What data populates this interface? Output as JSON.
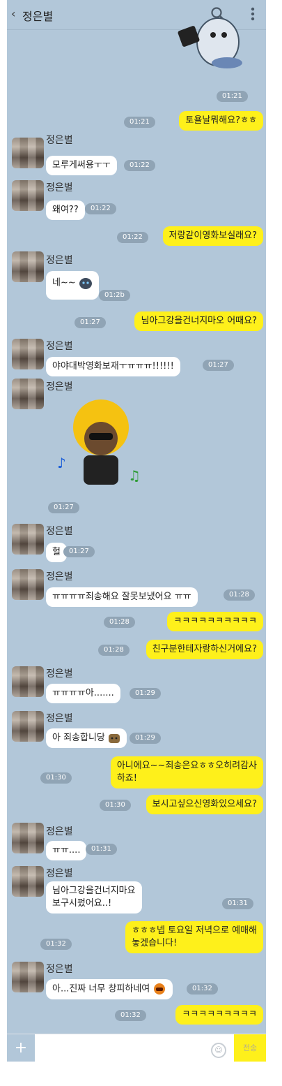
{
  "header": {
    "back_glyph": "‹",
    "title": "정은별",
    "search_icon": "search-icon",
    "menu_icon": "more-vert-icon"
  },
  "contact_name": "정은별",
  "messages": [
    {
      "dir": "sticker",
      "time": "01:21"
    },
    {
      "dir": "out",
      "text": "토욜날뭐해요?ㅎㅎ",
      "time": "01:21"
    },
    {
      "dir": "in",
      "name": "정은별",
      "text": "모루게써용ㅜㅜ",
      "time": "01:22"
    },
    {
      "dir": "in",
      "name": "정은별",
      "text": "왜여??",
      "time": "01:22"
    },
    {
      "dir": "out",
      "text": "저랑같이영화보실래요?",
      "time": "01:22"
    },
    {
      "dir": "in",
      "name": "정은별",
      "text": "네~~",
      "time": "01:2b"
    },
    {
      "dir": "out",
      "text": "님아그강을건너지마오 어때요?",
      "time": "01:27"
    },
    {
      "dir": "in",
      "name": "정은별",
      "text": "야야대박영화보재ㅜㅠㅠㅠ!!!!!!",
      "time": "01:27"
    },
    {
      "dir": "in-sticker",
      "name": "정은별",
      "time": "01:27"
    },
    {
      "dir": "in",
      "name": "정은별",
      "text": "헐",
      "time": "01:27"
    },
    {
      "dir": "in",
      "name": "정은별",
      "text": "ㅠㅠㅠㅠ죄송해요 잘못보냈어요 ㅠㅠ",
      "time": "01:28"
    },
    {
      "dir": "out",
      "text": "ㅋㅋㅋㅋㅋㅋㅋㅋㅋㅋ",
      "time": "01:28"
    },
    {
      "dir": "out",
      "text": "친구분한테자랑하신거에요?",
      "time": "01:28"
    },
    {
      "dir": "in",
      "name": "정은별",
      "text": "ㅠㅠㅠㅠ아.......",
      "time": "01:29"
    },
    {
      "dir": "in",
      "name": "정은별",
      "text": "아 죄송합니당",
      "time": "01:29"
    },
    {
      "dir": "out",
      "text": "아니에요~~죄송은요ㅎㅎ오히려감사\n하죠!",
      "time": "01:30"
    },
    {
      "dir": "out",
      "text": "보시고싶으신영화있으세요?",
      "time": "01:30"
    },
    {
      "dir": "in",
      "name": "정은별",
      "text": "ㅠㅠ....",
      "time": "01:31"
    },
    {
      "dir": "in",
      "name": "정은별",
      "text": "님아그강을건너지마요\n보구시펐어요..!",
      "time": "01:31"
    },
    {
      "dir": "out",
      "text": "ㅎㅎㅎ넵 토요일 저녁으로 예매해\n놓겠습니다!",
      "time": "01:32"
    },
    {
      "dir": "in",
      "name": "정은별",
      "text": "아...진짜 너무 창피하네여",
      "time": "01:32"
    },
    {
      "dir": "out",
      "text": "ㅋㅋㅋㅋㅋㅋㅋㅋㅋ",
      "time": "01:32"
    }
  ],
  "footer": {
    "plus_glyph": "+",
    "emoji_icon": "emoji-icon",
    "send_label": "전송"
  },
  "colors": {
    "background": "#b2c7d9",
    "outgoing": "#fef01b",
    "incoming": "#ffffff",
    "time_pill": "#90a4b5"
  }
}
